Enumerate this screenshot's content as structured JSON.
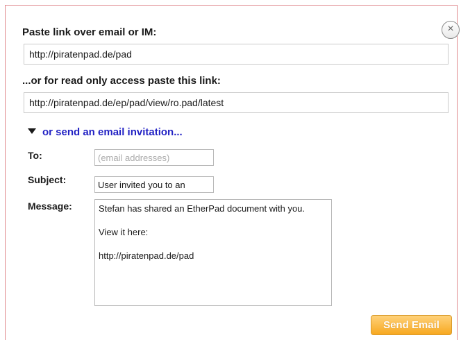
{
  "close_icon": "×",
  "share": {
    "link_label": "Paste link over email or IM:",
    "link_url": "http://piratenpad.de/pad",
    "readonly_label": "...or for read only access paste this link:",
    "readonly_url": "http://piratenpad.de/ep/pad/view/ro.pad/latest"
  },
  "invite": {
    "toggle_label": "or send an email invitation...",
    "to_label": "To:",
    "to_placeholder": "(email addresses)",
    "subject_label": "Subject:",
    "subject_value": "User invited you to an",
    "message_label": "Message:",
    "message_value": "Stefan has shared an EtherPad document with you.\n\nView it here:\n\nhttp://piratenpad.de/pad",
    "send_label": "Send Email"
  },
  "colors": {
    "link_blue": "#2323c4",
    "dialog_border": "#e0898d",
    "send_button": "#f7a820"
  }
}
